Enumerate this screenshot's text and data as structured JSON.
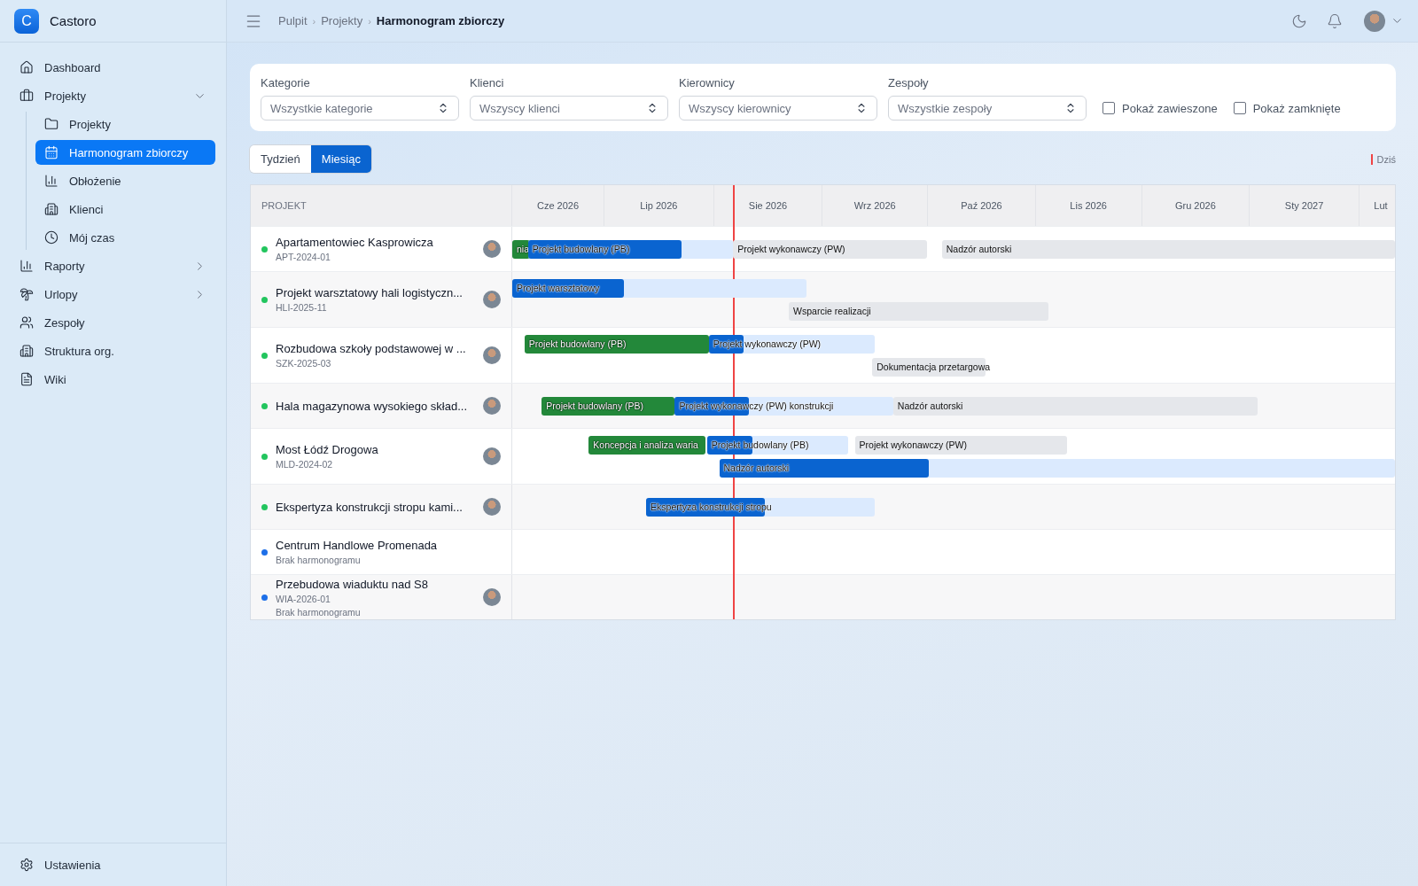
{
  "app": {
    "logo_letter": "C",
    "name": "Castoro"
  },
  "sidebar": {
    "items": [
      {
        "label": "Dashboard",
        "selected": false
      },
      {
        "label": "Projekty",
        "selected": false,
        "expanded": true,
        "children": [
          {
            "label": "Projekty",
            "selected": false
          },
          {
            "label": "Harmonogram zbiorczy",
            "selected": true
          },
          {
            "label": "Obłożenie",
            "selected": false
          },
          {
            "label": "Klienci",
            "selected": false
          },
          {
            "label": "Mój czas",
            "selected": false
          }
        ]
      },
      {
        "label": "Raporty",
        "selected": false,
        "expanded": false
      },
      {
        "label": "Urlopy",
        "selected": false,
        "expanded": false
      },
      {
        "label": "Zespoły",
        "selected": false
      },
      {
        "label": "Struktura org.",
        "selected": false
      },
      {
        "label": "Wiki",
        "selected": false
      }
    ],
    "footer": {
      "label": "Ustawienia"
    }
  },
  "breadcrumbs": [
    "Pulpit",
    "Projekty",
    "Harmonogram zbiorczy"
  ],
  "breadcrumb_separator": "›",
  "filters": {
    "selects": [
      {
        "label": "Kategorie",
        "placeholder": "Wszystkie kategorie"
      },
      {
        "label": "Klienci",
        "placeholder": "Wszyscy klienci"
      },
      {
        "label": "Kierownicy",
        "placeholder": "Wszyscy kierownicy"
      },
      {
        "label": "Zespoły",
        "placeholder": "Wszystkie zespoły"
      }
    ],
    "checkboxes": [
      {
        "label": "Pokaż zawieszone",
        "checked": false
      },
      {
        "label": "Pokaż zamknięte",
        "checked": false
      }
    ]
  },
  "view_tabs": [
    {
      "label": "Tydzień",
      "selected": false
    },
    {
      "label": "Miesiąc",
      "selected": true
    }
  ],
  "legend": {
    "today": "Dziś"
  },
  "timeline": {
    "project_header": "PROJEKT",
    "months": [
      "Cze 2026",
      "Lip 2026",
      "Sie 2026",
      "Wrz 2026",
      "Paź 2026",
      "Lis 2026",
      "Gru 2026",
      "Sty 2027",
      "Lut"
    ],
    "rows": [
      {
        "name": "Apartamentowiec Kasprowicza",
        "code": "APT-2024-01",
        "color": "#22c55e",
        "avatar": true,
        "lanes": [
          [
            {
              "label": "nia",
              "kind": "done"
            },
            {
              "label": "Projekt budowlany (PB)",
              "kind": "active",
              "level": 0.75
            },
            {
              "label": "Projekt wykonawczy (PW)",
              "kind": "planned"
            },
            {
              "label": "Nadzór autorski",
              "kind": "planned"
            }
          ]
        ]
      },
      {
        "name": "Projekt warsztatowy hali logistyczn...",
        "code": "HLI-2025-11",
        "color": "#22c55e",
        "avatar": true,
        "lanes": [
          [
            {
              "label": "Projekt warsztatowy",
              "kind": "active",
              "level": 0.38
            }
          ],
          [
            {
              "label": "Wsparcie realizacji",
              "kind": "planned"
            }
          ]
        ]
      },
      {
        "name": "Rozbudowa szkoły podstawowej w ...",
        "code": "SZK-2025-03",
        "color": "#22c55e",
        "avatar": true,
        "lanes": [
          [
            {
              "label": "Projekt budowlany (PB)",
              "kind": "done"
            },
            {
              "label": "Projekt wykonawczy (PW)",
              "kind": "active",
              "level": 0.21
            }
          ],
          [
            {
              "label": "Dokumentacja przetargowa",
              "kind": "planned"
            }
          ]
        ]
      },
      {
        "name": "Hala magazynowa wysokiego skład...",
        "color": "#22c55e",
        "avatar": true,
        "lanes": [
          [
            {
              "label": "Projekt budowlany (PB)",
              "kind": "done"
            },
            {
              "label": "Projekt wykonawczy (PW) konstrukcji",
              "kind": "active",
              "level": 0.34
            },
            {
              "label": "Nadzór autorski",
              "kind": "planned"
            }
          ]
        ]
      },
      {
        "name": "Most Łódź Drogowa",
        "code": "MLD-2024-02",
        "color": "#22c55e",
        "avatar": true,
        "lanes": [
          [
            {
              "label": "Koncepcja i analiza waria",
              "kind": "done"
            },
            {
              "label": "Projekt budowlany (PB)",
              "kind": "active",
              "level": 0.32
            },
            {
              "label": "Projekt wykonawczy (PW)",
              "kind": "planned"
            }
          ],
          [
            {
              "label": "Nadzór autorski",
              "kind": "active",
              "level": 0.31
            }
          ]
        ]
      },
      {
        "name": "Ekspertyza konstrukcji stropu kami...",
        "color": "#22c55e",
        "avatar": true,
        "lanes": [
          [
            {
              "label": "Ekspertyza konstrukcji stropu",
              "kind": "active",
              "level": 0.52
            }
          ]
        ]
      },
      {
        "name": "Centrum Handlowe Promenada",
        "note": "Brak harmonogramu",
        "color": "#1d6fe8",
        "avatar": false,
        "lanes": []
      },
      {
        "name": "Przebudowa wiaduktu nad S8",
        "code": "WIA-2026-01",
        "note": "Brak harmonogramu",
        "color": "#1d6fe8",
        "avatar": true,
        "lanes": []
      }
    ]
  }
}
